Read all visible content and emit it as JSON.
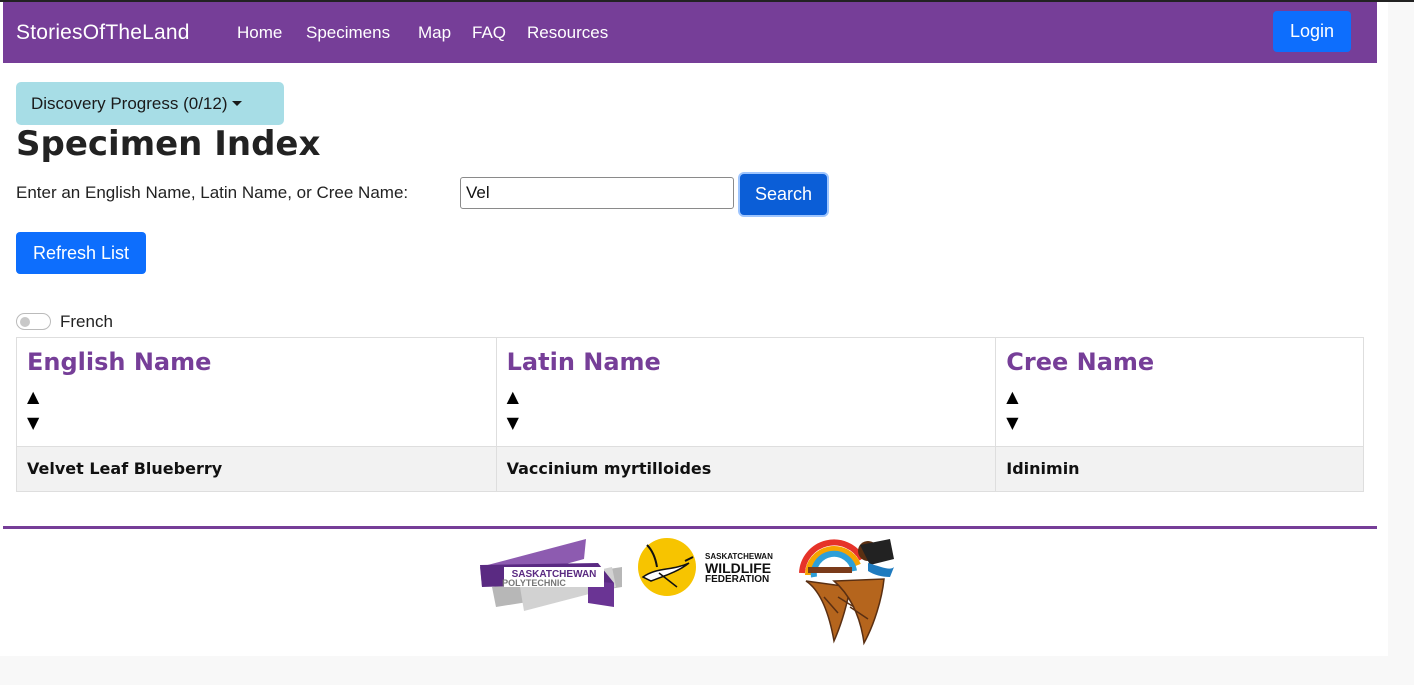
{
  "navbar": {
    "brand": "StoriesOfTheLand",
    "links": [
      "Home",
      "Specimens",
      "Map",
      "FAQ",
      "Resources"
    ],
    "login": "Login"
  },
  "progress_button": "Discovery Progress (0/12)",
  "page_title": "Specimen Index",
  "search": {
    "label": "Enter an English Name, Latin Name, or Cree Name:",
    "value": "Vel",
    "button": "Search"
  },
  "refresh_button": "Refresh List",
  "french_toggle": {
    "label": "French",
    "checked": false
  },
  "table": {
    "headers": [
      "English Name",
      "Latin Name",
      "Cree Name"
    ],
    "sort_up": "▲",
    "sort_down": "▼",
    "rows": [
      [
        "Velvet Leaf Blueberry",
        "Vaccinium myrtilloides",
        "Idinimin"
      ]
    ]
  },
  "footer": {
    "polytech_line1": "SASKATCHEWAN",
    "polytech_line2": "POLYTECHNIC",
    "wildlife_line1": "SASKATCHEWAN",
    "wildlife_line2": "WILDLIFE",
    "wildlife_line3": "FEDERATION"
  },
  "colors": {
    "brand_purple": "#763e98",
    "primary_blue": "#0d6efd",
    "info_cyan": "#a7dde6"
  }
}
